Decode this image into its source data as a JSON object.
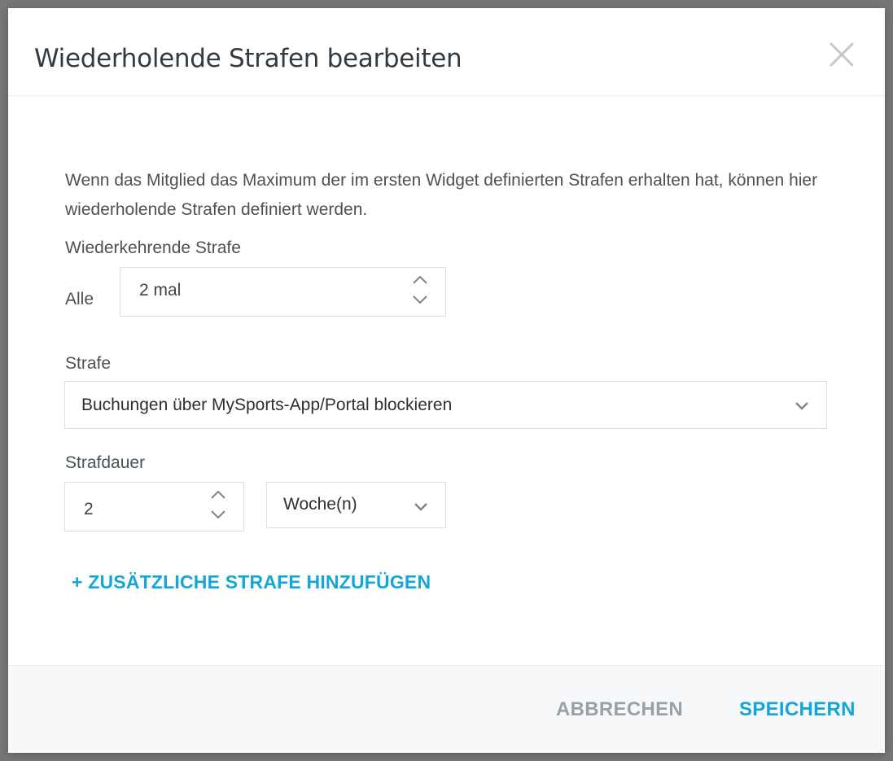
{
  "dialog": {
    "title": "Wiederholende Strafen bearbeiten",
    "description": "Wenn das Mitglied das Maximum der im ersten Widget definierten Strafen erhalten hat, können hier wiederholende Strafen definiert werden."
  },
  "recurring": {
    "label": "Wiederkehrende Strafe",
    "every_label": "Alle",
    "value": "2 mal"
  },
  "penalty": {
    "label": "Strafe",
    "selected": "Buchungen über MySports-App/Portal blockieren"
  },
  "duration": {
    "label": "Strafdauer",
    "amount": "2",
    "unit": "Woche(n)"
  },
  "add_link": "+ ZUSÄTZLICHE STRAFE HINZUFÜGEN",
  "footer": {
    "cancel_label": "ABBRECHEN",
    "save_label": "SPEICHERN"
  },
  "icons": {
    "close": "close-icon",
    "increment": "chevron-up-icon",
    "decrement": "chevron-down-icon",
    "dropdown": "chevron-down-icon"
  },
  "colors": {
    "accent": "#13a7d8",
    "muted_button": "#9aa1a6",
    "backdrop": "#777777"
  }
}
